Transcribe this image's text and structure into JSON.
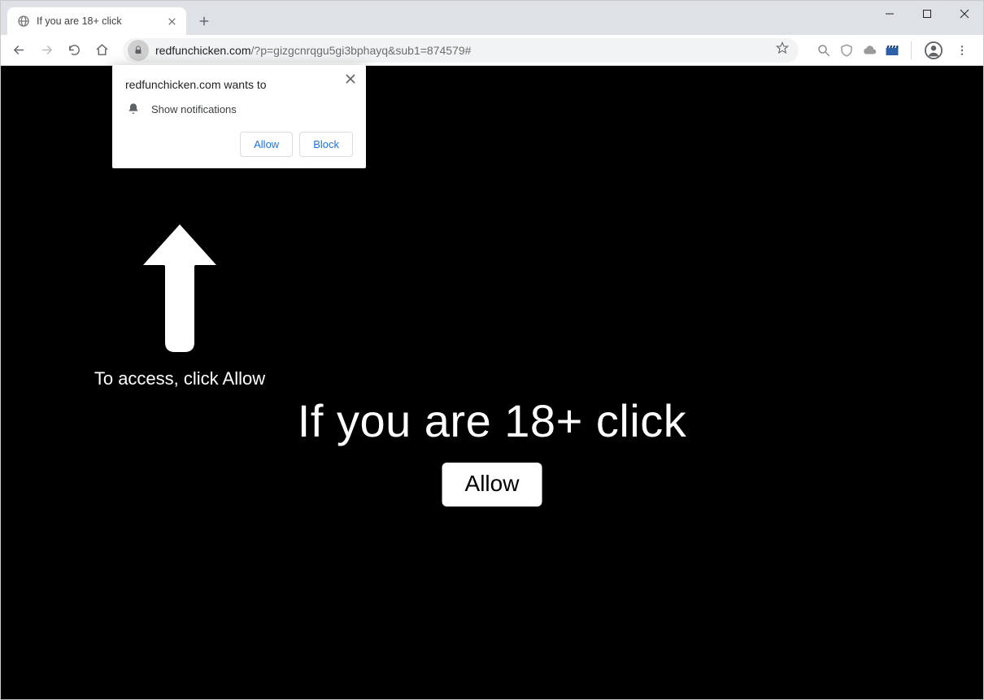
{
  "titlebar": {
    "tab_title": "If you are 18+ click"
  },
  "toolbar": {
    "url_domain": "redfunchicken.com",
    "url_path": "/?p=gizgcnrqgu5gi3bphayq&sub1=874579#"
  },
  "perm_prompt": {
    "title": "redfunchicken.com wants to",
    "capability": "Show notifications",
    "allow_label": "Allow",
    "block_label": "Block"
  },
  "page": {
    "access_text": "To access, click Allow",
    "headline": "If you are 18+ click",
    "allow_button": "Allow"
  }
}
